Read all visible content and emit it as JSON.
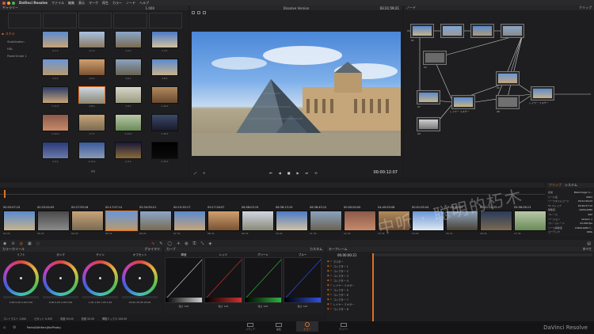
{
  "menubar": {
    "app_name": "DaVinci Resolve",
    "menus": [
      "ファイル",
      "編集",
      "表示",
      "マーク",
      "再生",
      "カラー",
      "ノード",
      "ヘルプ"
    ],
    "time": "03:21:59:21",
    "project_title": "Dissolve Version"
  },
  "gallery": {
    "title": "ギャラリー",
    "album_label": "1.000",
    "albums": [
      "スチル",
      "Stabilization",
      "HDL",
      "PowerGrade 1"
    ],
    "stills": [
      {
        "label": "2.1.1"
      },
      {
        "label": "1.1.1"
      },
      {
        "label": "1.2.1"
      },
      {
        "label": "1.3.1"
      },
      {
        "label": "1.4.1"
      },
      {
        "label": "1.5.1"
      },
      {
        "label": "1.6.1"
      },
      {
        "label": "1.8.1"
      },
      {
        "label": "1.11.1"
      },
      {
        "label": "1.8.1"
      },
      {
        "label": "1.9.1"
      },
      {
        "label": "1.10.1"
      },
      {
        "label": "1.12.1"
      },
      {
        "label": "1.7.1"
      },
      {
        "label": "1.13.1"
      },
      {
        "label": "1.16.1"
      },
      {
        "label": "2.4.1"
      },
      {
        "label": "1.14.1"
      },
      {
        "label": "2.3.1"
      },
      {
        "label": "1.15.1"
      }
    ]
  },
  "viewer": {
    "title": "Dissolve Version",
    "timecode": "00:00:12:07"
  },
  "nodes": {
    "title": "ノード",
    "right_title": "クリップ",
    "labels": [
      "01",
      "03",
      "02",
      "04",
      "レイヤー ミキサー",
      "07",
      "レイヤー ミキサー",
      "08",
      "06",
      "09"
    ]
  },
  "timeline": {
    "clips": [
      {
        "tc": "00:25:07:15",
        "num": "02",
        "v": "V1"
      },
      {
        "tc": "00:25:00:05",
        "num": "03",
        "v": "V1"
      },
      {
        "tc": "00:27:59:18",
        "num": "04",
        "v": "V1"
      },
      {
        "tc": "00:17:07:12",
        "num": "05",
        "v": "V1"
      },
      {
        "tc": "05:34:59:21",
        "num": "06",
        "v": "V1"
      },
      {
        "tc": "00:15:35:17",
        "num": "07",
        "v": "V1"
      },
      {
        "tc": "09:17:26:07",
        "num": "08",
        "v": "V1"
      },
      {
        "tc": "06:58:03:19",
        "num": "09",
        "v": "V1"
      },
      {
        "tc": "06:36:13:19",
        "num": "10",
        "v": "V1"
      },
      {
        "tc": "06:38:45:12",
        "num": "11",
        "v": "V1"
      },
      {
        "tc": "00:00:00:00",
        "num": "12",
        "v": "V1"
      },
      {
        "tc": "04:45:05:08",
        "num": "13",
        "v": "V1"
      },
      {
        "tc": "00:01:05:04",
        "num": "14",
        "v": "V1"
      },
      {
        "tc": "13:29:40:12",
        "num": "15",
        "v": "V1"
      },
      {
        "tc": "00:21:22:25",
        "num": "16",
        "v": "V1"
      },
      {
        "tc": "05:58:28:13",
        "num": "17",
        "v": "V1"
      }
    ]
  },
  "info_panel": {
    "tabs": [
      "クリップ",
      "システム"
    ],
    "rows": [
      [
        "名前",
        "Blackmagic C..."
      ],
      [
        "リール名",
        "0001"
      ],
      [
        "ソースタイムコード",
        "03:21:59:03"
      ],
      [
        "TC ストップ",
        "03:29:57:12"
      ],
      [
        "解像度 ",
        "1920x1080"
      ],
      [
        "フレーム",
        "492"
      ],
      [
        "バージョン",
        "Version 1"
      ],
      [
        "フレームレート",
        "24.000 fps"
      ],
      [
        "ソース解像度",
        "2400x1080 Y..."
      ],
      [
        "コーデック",
        "DNG"
      ]
    ]
  },
  "color": {
    "title": "カラーホイール",
    "mode": "プライマリ",
    "wheels": [
      {
        "name": "リフト",
        "values": "0.00 0.00 0.00 0.00"
      },
      {
        "name": "ガンマ",
        "values": "0.00 0.00 0.00 0.00"
      },
      {
        "name": "ゲイン",
        "values": "1.00 1.00 1.00 1.00"
      },
      {
        "name": "オフセット",
        "values": "25.00 25.00 25.00"
      }
    ],
    "curves_title": "カーブ",
    "curves": [
      {
        "name": "輝度",
        "color": "#cccccc",
        "strength_label": "強さ",
        "strength": "100"
      },
      {
        "name": "レッド",
        "color": "#d03030",
        "strength_label": "強さ",
        "strength": "100"
      },
      {
        "name": "グリーン",
        "color": "#30b040",
        "strength_label": "強さ",
        "strength": "100"
      },
      {
        "name": "ブルー",
        "color": "#3050e0",
        "strength_label": "強さ",
        "strength": "100"
      }
    ],
    "custom_label": "カスタム"
  },
  "keyframes": {
    "title": "キーフレーム",
    "timecode": "00:00:00:21",
    "mode": "すべて",
    "items": [
      "マスター",
      "コレクター 1",
      "コレクター 2",
      "コレクター 3",
      "コレクター 4",
      "レイヤー ミキサー",
      "コレクター 5",
      "コレクター 6",
      "コレクター 7",
      "レイヤー ミキサー",
      "コレクター 8"
    ]
  },
  "bottom_params": {
    "contrast": "コントラスト 1.000",
    "pivot": "ピボット 0.435",
    "sat": "彩度 50.00",
    "hue": "色相 50.00",
    "lum": "輝度ミックス 100.00"
  },
  "statusbar": {
    "project": "Parks&Writers(tiloPhoto)",
    "pages": [
      "メディア",
      "編集",
      "カラー",
      "デリバー"
    ],
    "brand": "DaVinci Resolve"
  },
  "watermark": "中听 · 聪明的朽木",
  "colors": {
    "accent": "#e07020",
    "background": "#1c1c1e"
  }
}
